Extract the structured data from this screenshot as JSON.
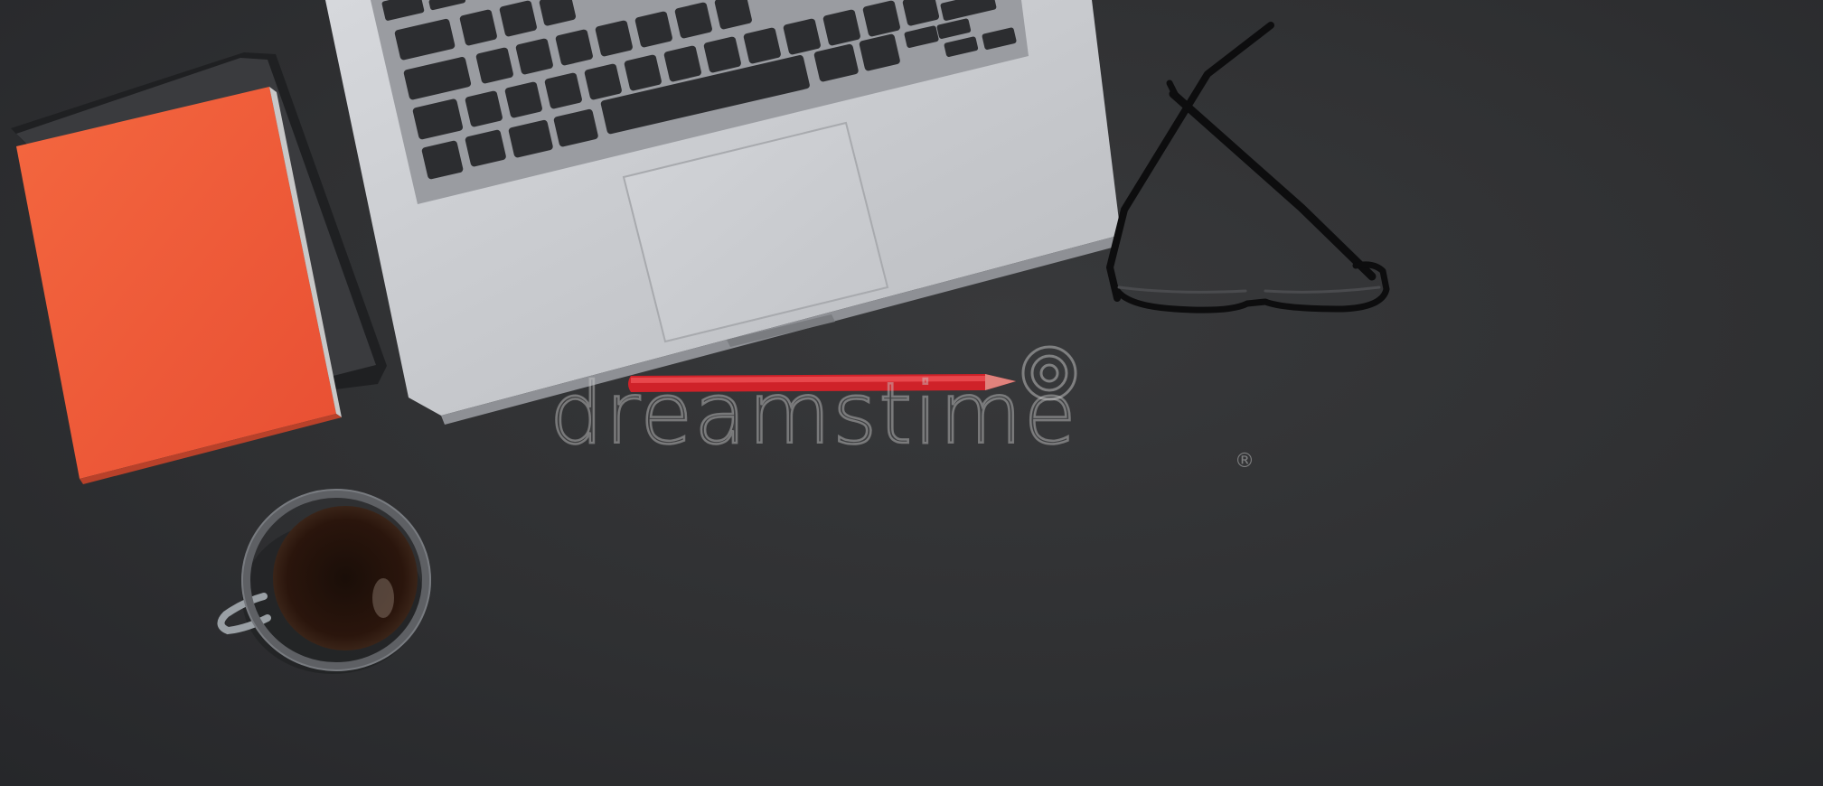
{
  "watermark": {
    "text": "dreamstime",
    "registered": "®"
  },
  "colors": {
    "desk": "#2e2f31",
    "notebook": "#ef5a3c",
    "laptop": "#c9cbcf",
    "pencil": "#d0242a"
  },
  "objects": [
    "notebook-icon",
    "laptop-icon",
    "glasses-icon",
    "pencil-icon",
    "coffee-cup-icon"
  ]
}
